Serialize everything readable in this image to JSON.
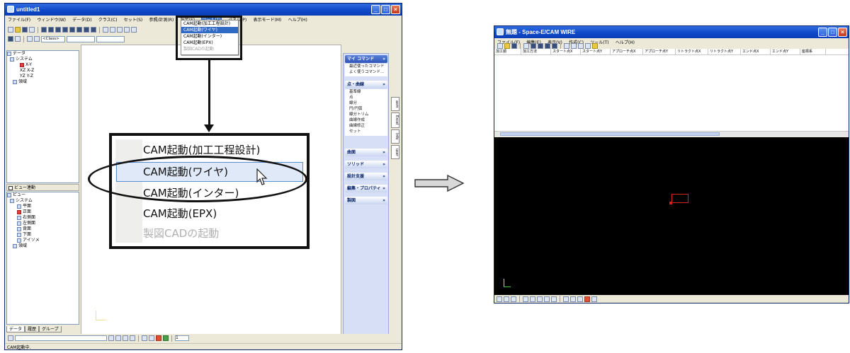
{
  "left_window": {
    "title": "untitled1",
    "menu": [
      "ファイル(F)",
      "ウィンドウ(W)",
      "データ(D)",
      "クラス(C)",
      "セット(S)",
      "参照/計測(R)",
      "設定(S)",
      "ツール(T)",
      "パネル(P)",
      "表示モード(M)",
      "ヘルプ(H)"
    ],
    "active_menu_index": 7,
    "class_combo": "<Class>",
    "dropdown_items": [
      "CAM起動(加工工程設計)",
      "CAM起動(ワイヤ)",
      "CAM起動(インター)",
      "CAM起動(EPX)",
      "製図CADの起動"
    ],
    "dropdown_highlight_index": 1,
    "dropdown_disabled_index": 4,
    "data_tree": {
      "root": "データ",
      "system": "システム",
      "items": [
        "X-Y",
        "X-Z",
        "Y-Z",
        "領域"
      ],
      "prefixes": [
        "XY",
        "XZ",
        "YZ",
        ""
      ]
    },
    "view_link": "ビュー連動",
    "view_tree": {
      "root": "ビュー",
      "system": "システム",
      "items": [
        "平面",
        "正面",
        "右側面",
        "左側面",
        "背面",
        "下面",
        "アイソメ"
      ],
      "area": "領域"
    },
    "bottom_tabs": [
      "データ",
      "履歴",
      "グループ"
    ],
    "status": "CAM起動中.",
    "command_panel": {
      "my_command": "マイ コマンド",
      "recent": [
        "最近使ったコマンド",
        "よく使うコマンド..."
      ],
      "point_curve": "点・曲線",
      "point_curve_items": [
        "基準線",
        "点",
        "線分",
        "円/円弧",
        "線分トリム",
        "曲線作成",
        "曲線修正",
        "セット"
      ],
      "sections": [
        "曲面",
        "ソリッド",
        "設計支援",
        "編集・プロパティ",
        "製図"
      ]
    },
    "side_tabs": [
      "asm",
      "Excel",
      "Info",
      "user"
    ],
    "page_field": "1"
  },
  "zoom_menu": {
    "items": [
      "CAM起動(加工工程設計)",
      "CAM起動(ワイヤ)",
      "CAM起動(インター)",
      "CAM起動(EPX)",
      "製図CADの起動"
    ],
    "highlight_index": 1,
    "disabled_index": 4
  },
  "right_window": {
    "title": "無題 - Space-E/CAM WIRE",
    "menu": [
      "ファイル(F)",
      "編集(E)",
      "表示(V)",
      "作成(C)",
      "ツール(T)",
      "ヘルプ(H)"
    ],
    "columns": [
      "加工順",
      "加工方法",
      "スタート点X",
      "スタート点Y",
      "アプローチ点X",
      "アプローチ点Y",
      "リトラクト点X",
      "リトラクト点Y",
      "エンド点X",
      "エンド点Y",
      "座標系"
    ]
  },
  "colors": {
    "titlebar": "#1049c8",
    "highlight": "#316ac5",
    "canvas": "#000000",
    "marker": "#d02020"
  }
}
